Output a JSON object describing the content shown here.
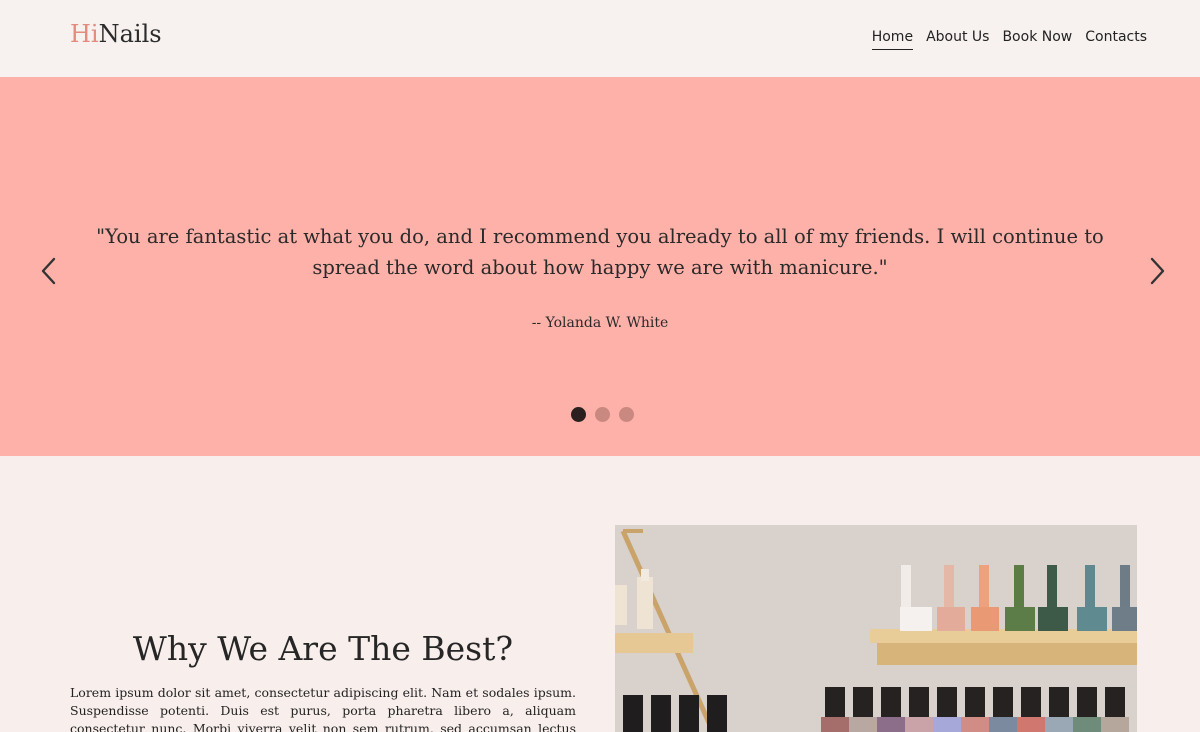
{
  "header": {
    "logo_accent": "Hi",
    "logo_rest": "Nails",
    "nav": [
      {
        "label": "Home",
        "active": true
      },
      {
        "label": "About Us",
        "active": false
      },
      {
        "label": "Book Now",
        "active": false
      },
      {
        "label": "Contacts",
        "active": false
      }
    ]
  },
  "hero": {
    "background": "#feb1a9",
    "quote": "\"You are fantastic at what you do, and I recommend you already to all of my friends. I will continue to spread the word about how happy we are with manicure.\"",
    "author": "-- Yolanda W. White",
    "prev_icon": "chevron-left-icon",
    "next_icon": "chevron-right-icon",
    "slides_total": 3,
    "active_slide": 1
  },
  "section": {
    "title": "Why We Are The Best?",
    "body": "Lorem ipsum dolor sit amet, consectetur adipiscing elit. Nam et sodales ipsum. Suspendisse potenti. Duis est purus, porta pharetra libero a, aliquam consectetur nunc. Morbi viverra velit non sem rutrum, sed accumsan lectus sodales. In risus"
  },
  "colors": {
    "accent": "#e58a7f",
    "page_bg": "#f8efec",
    "header_bg": "#f7f2ef"
  }
}
